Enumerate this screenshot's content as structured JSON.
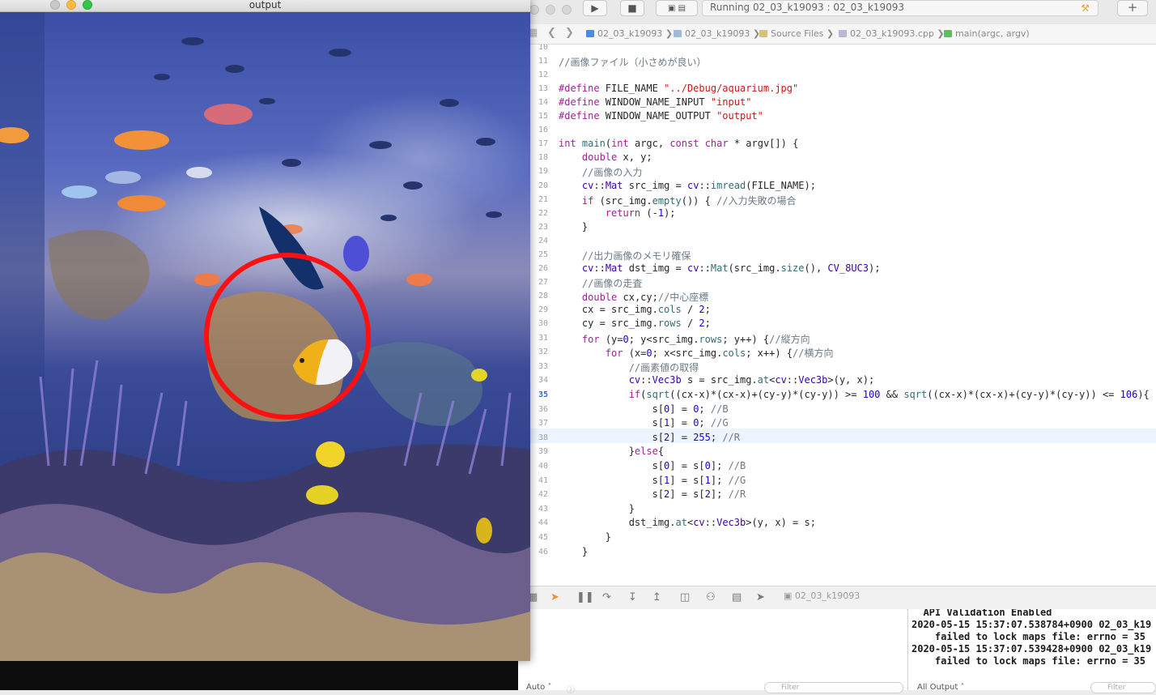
{
  "opencv_window": {
    "title": "output"
  },
  "xcode": {
    "activity": "Running 02_03_k19093 : 02_03_k19093",
    "breadcrumbs": [
      {
        "label": "02_03_k19093",
        "icon": "project-file-icon",
        "color": "#4a8ce0"
      },
      {
        "label": "02_03_k19093",
        "icon": "folder-icon",
        "color": "#9fb9d6"
      },
      {
        "label": "Source Files",
        "icon": "folder-icon",
        "color": "#d9c17a"
      },
      {
        "label": "02_03_k19093.cpp",
        "icon": "cpp-file-icon",
        "color": "#b8b8d8"
      },
      {
        "label": "main(argc, argv)",
        "icon": "function-icon",
        "color": "#5cbf63"
      }
    ],
    "current_line": "35",
    "debug_target": "02_03_k19093",
    "console_lines": [
      "  API Validation Enabled",
      "2020-05-15 15:37:07.538784+0900 02_03_k19",
      "    failed to lock maps file: errno = 35",
      "2020-05-15 15:37:07.539428+0900 02_03_k19",
      "    failed to lock maps file: errno = 35"
    ],
    "vars_scope": "Auto ˄",
    "console_scope": "All Output ˄",
    "filter_placeholder": "Filter"
  },
  "code": {
    "lines": [
      {
        "n": "10",
        "html": ""
      },
      {
        "n": "11",
        "html": "<span class='cm'>//画像ファイル（小さめが良い）</span>"
      },
      {
        "n": "12",
        "html": ""
      },
      {
        "n": "13",
        "html": "<span class='kw'>#define</span> FILE_NAME <span class='st'>\"../Debug/aquarium.jpg\"</span>"
      },
      {
        "n": "14",
        "html": "<span class='kw'>#define</span> WINDOW_NAME_INPUT <span class='st'>\"input\"</span>"
      },
      {
        "n": "15",
        "html": "<span class='kw'>#define</span> WINDOW_NAME_OUTPUT <span class='st'>\"output\"</span>"
      },
      {
        "n": "16",
        "html": ""
      },
      {
        "n": "17",
        "html": "<span class='kw'>int</span> <span class='fn'>main</span>(<span class='kw'>int</span> argc, <span class='kw'>const</span> <span class='kw'>char</span> * argv[]) {"
      },
      {
        "n": "18",
        "html": "    <span class='kw'>double</span> x, y;"
      },
      {
        "n": "19",
        "html": "    <span class='cm'>//画像の入力</span>"
      },
      {
        "n": "20",
        "html": "    <span class='ty'>cv</span>::<span class='ty'>Mat</span> src_img = <span class='ty'>cv</span>::<span class='fn'>imread</span>(FILE_NAME);"
      },
      {
        "n": "21",
        "html": "    <span class='kw'>if</span> (src_img.<span class='fn'>empty</span>()) { <span class='cm'>//入力失敗の場合</span>"
      },
      {
        "n": "22",
        "html": "        <span class='kw'>return</span> (-<span class='nm'>1</span>);"
      },
      {
        "n": "23",
        "html": "    }"
      },
      {
        "n": "24",
        "html": ""
      },
      {
        "n": "25",
        "html": "    <span class='cm'>//出力画像のメモリ確保</span>"
      },
      {
        "n": "26",
        "html": "    <span class='ty'>cv</span>::<span class='ty'>Mat</span> dst_img = <span class='ty'>cv</span>::<span class='fn'>Mat</span>(src_img.<span class='fn'>size</span>(), <span class='ty'>CV_8UC3</span>);"
      },
      {
        "n": "27",
        "html": "    <span class='cm'>//画像の走査</span>"
      },
      {
        "n": "28",
        "html": "    <span class='kw'>double</span> cx,cy;<span class='cm'>//中心座標</span>"
      },
      {
        "n": "29",
        "html": "    cx = src_img.<span class='fn'>cols</span> / <span class='nm'>2</span>;"
      },
      {
        "n": "30",
        "html": "    cy = src_img.<span class='fn'>rows</span> / <span class='nm'>2</span>;"
      },
      {
        "n": "31",
        "html": "    <span class='kw'>for</span> (y=<span class='nm'>0</span>; y&lt;src_img.<span class='fn'>rows</span>; y++) {<span class='cm'>//縦方向</span>"
      },
      {
        "n": "32",
        "html": "        <span class='kw'>for</span> (x=<span class='nm'>0</span>; x&lt;src_img.<span class='fn'>cols</span>; x++) {<span class='cm'>//横方向</span>"
      },
      {
        "n": "33",
        "html": "            <span class='cm'>//画素値の取得</span>"
      },
      {
        "n": "34",
        "html": "            <span class='ty'>cv</span>::<span class='ty'>Vec3b</span> s = src_img.<span class='fn'>at</span>&lt;<span class='ty'>cv</span>::<span class='ty'>Vec3b</span>&gt;(y, x);"
      },
      {
        "n": "35",
        "html": "            <span class='kw'>if</span>(<span class='fn'>sqrt</span>((cx-x)*(cx-x)+(cy-y)*(cy-y)) &gt;= <span class='nm'>100</span> &amp;&amp; <span class='fn'>sqrt</span>((cx-x)*(cx-x)+(cy-y)*(cy-y)) &lt;= <span class='nm'>106</span>){"
      },
      {
        "n": "36",
        "html": "                s[<span class='nm'>0</span>] = <span class='nm'>0</span>; <span class='cm'>//B</span>"
      },
      {
        "n": "37",
        "html": "                s[<span class='nm'>1</span>] = <span class='nm'>0</span>; <span class='cm'>//G</span>"
      },
      {
        "n": "38",
        "html": "                s[<span class='nm'>2</span>] = <span class='nm'>255</span>; <span class='cm'>//R</span>"
      },
      {
        "n": "39",
        "html": "            }<span class='kw'>else</span>{"
      },
      {
        "n": "40",
        "html": "                s[<span class='nm'>0</span>] = s[<span class='nm'>0</span>]; <span class='cm'>//B</span>"
      },
      {
        "n": "41",
        "html": "                s[<span class='nm'>1</span>] = s[<span class='nm'>1</span>]; <span class='cm'>//G</span>"
      },
      {
        "n": "42",
        "html": "                s[<span class='nm'>2</span>] = s[<span class='nm'>2</span>]; <span class='cm'>//R</span>"
      },
      {
        "n": "43",
        "html": "            }"
      },
      {
        "n": "44",
        "html": "            dst_img.<span class='fn'>at</span>&lt;<span class='ty'>cv</span>::<span class='ty'>Vec3b</span>&gt;(y, x) = s;"
      },
      {
        "n": "45",
        "html": "        }"
      },
      {
        "n": "46",
        "html": "    }"
      }
    ]
  }
}
